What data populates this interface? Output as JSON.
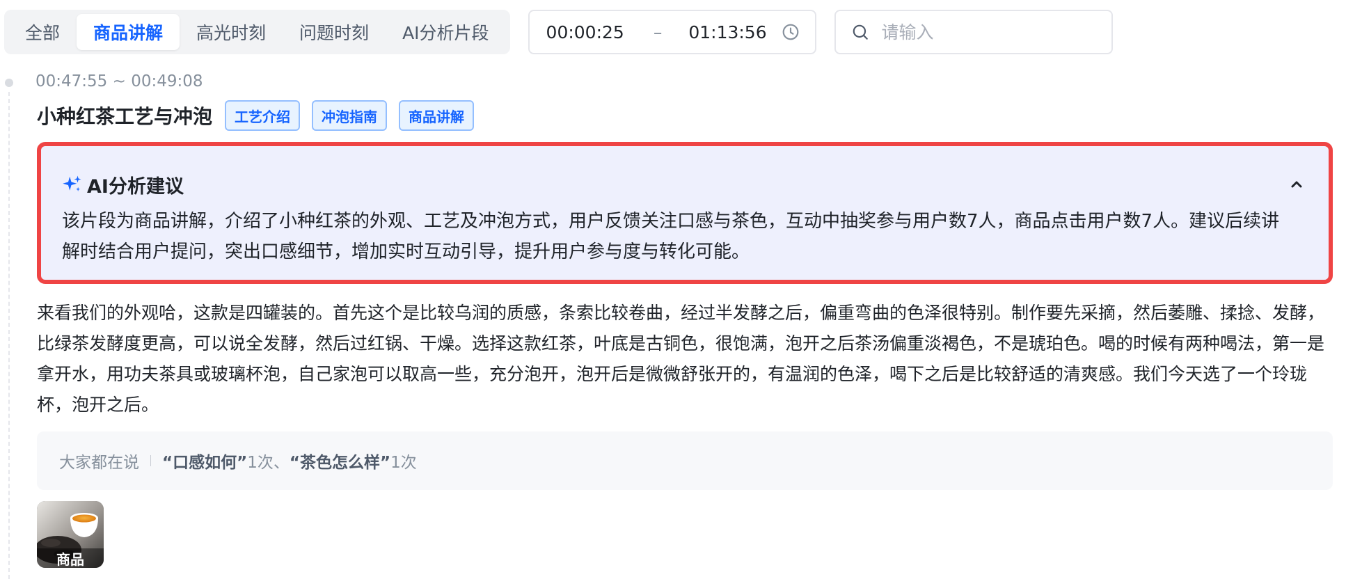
{
  "tabs": [
    {
      "label": "全部",
      "active": false
    },
    {
      "label": "商品讲解",
      "active": true
    },
    {
      "label": "高光时刻",
      "active": false
    },
    {
      "label": "问题时刻",
      "active": false
    },
    {
      "label": "AI分析片段",
      "active": false
    }
  ],
  "time_filter": {
    "start": "00:00:25",
    "separator": "–",
    "end": "01:13:56"
  },
  "search": {
    "placeholder": "请输入",
    "value": ""
  },
  "segment": {
    "time_range": "00:47:55 ~ 00:49:08",
    "title": "小种红茶工艺与冲泡",
    "tags": [
      "工艺介绍",
      "冲泡指南",
      "商品讲解"
    ],
    "ai": {
      "title": "AI分析建议",
      "text": "该片段为商品讲解，介绍了小种红茶的外观、工艺及冲泡方式，用户反馈关注口感与茶色，互动中抽奖参与用户数7人，商品点击用户数7人。建议后续讲解时结合用户提问，突出口感细节，增加实时互动引导，提升用户参与度与转化可能。"
    },
    "transcript": "来看我们的外观哈，这款是四罐装的。首先这个是比较乌润的质感，条索比较卷曲，经过半发酵之后，偏重弯曲的色泽很特别。制作要先采摘，然后萎雕、揉捻、发酵，比绿茶发酵度更高，可以说全发酵，然后过红锅、干燥。选择这款红茶，叶底是古铜色，很饱满，泡开之后茶汤偏重淡褐色，不是琥珀色。喝的时候有两种喝法，第一是拿开水，用功夫茶具或玻璃杯泡，自己家泡可以取高一些，充分泡开，泡开后是微微舒张开的，有温润的色泽，喝下之后是比较舒适的清爽感。我们今天选了一个玲珑杯，泡开之后。",
    "comments": {
      "label": "大家都在说",
      "items": [
        {
          "keyword": "“口感如何”",
          "count": "1次"
        },
        {
          "separator": "、"
        },
        {
          "keyword": "“茶色怎么样”",
          "count": "1次"
        }
      ]
    },
    "product": {
      "label": "商品"
    }
  },
  "colors": {
    "accent": "#1664ff",
    "highlight_border": "#ef4444",
    "ai_bg": "#eef0fd"
  }
}
